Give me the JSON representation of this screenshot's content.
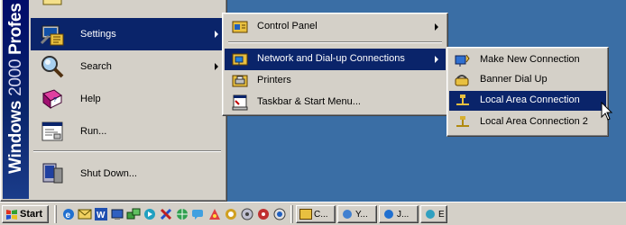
{
  "start_menu": {
    "banner_bold": "Windows",
    "banner_thin": " 2000",
    "banner_rest": " Profes",
    "items": [
      {
        "label": "Settings",
        "icon": "settings-icon"
      },
      {
        "label": "Search",
        "icon": "search-icon"
      },
      {
        "label": "Help",
        "icon": "help-book-icon"
      },
      {
        "label": "Run...",
        "icon": "run-icon"
      },
      {
        "label": "Shut Down...",
        "icon": "shut-down-icon"
      }
    ]
  },
  "settings_menu": {
    "items": [
      {
        "label": "Control Panel",
        "icon": "control-panel-icon"
      },
      {
        "label": "Network and Dial-up Connections",
        "icon": "network-connections-icon"
      },
      {
        "label": "Printers",
        "icon": "printers-icon"
      },
      {
        "label": "Taskbar & Start Menu...",
        "icon": "taskbar-icon"
      }
    ]
  },
  "network_menu": {
    "items": [
      {
        "label": "Make New Connection",
        "icon": "make-new-connection-icon"
      },
      {
        "label": "Banner Dial Up",
        "icon": "dial-up-icon"
      },
      {
        "label": "Local Area Connection",
        "icon": "lan-icon"
      },
      {
        "label": "Local Area Connection 2",
        "icon": "lan-icon"
      }
    ]
  },
  "taskbar": {
    "start_label": "Start",
    "tasks": [
      "C...",
      "Y...",
      "J...",
      "E"
    ]
  },
  "colors": {
    "desktop": "#3a6ea5",
    "menu_face": "#d4d0c8",
    "highlight": "#0a246a",
    "highlight_text": "#ffffff"
  }
}
